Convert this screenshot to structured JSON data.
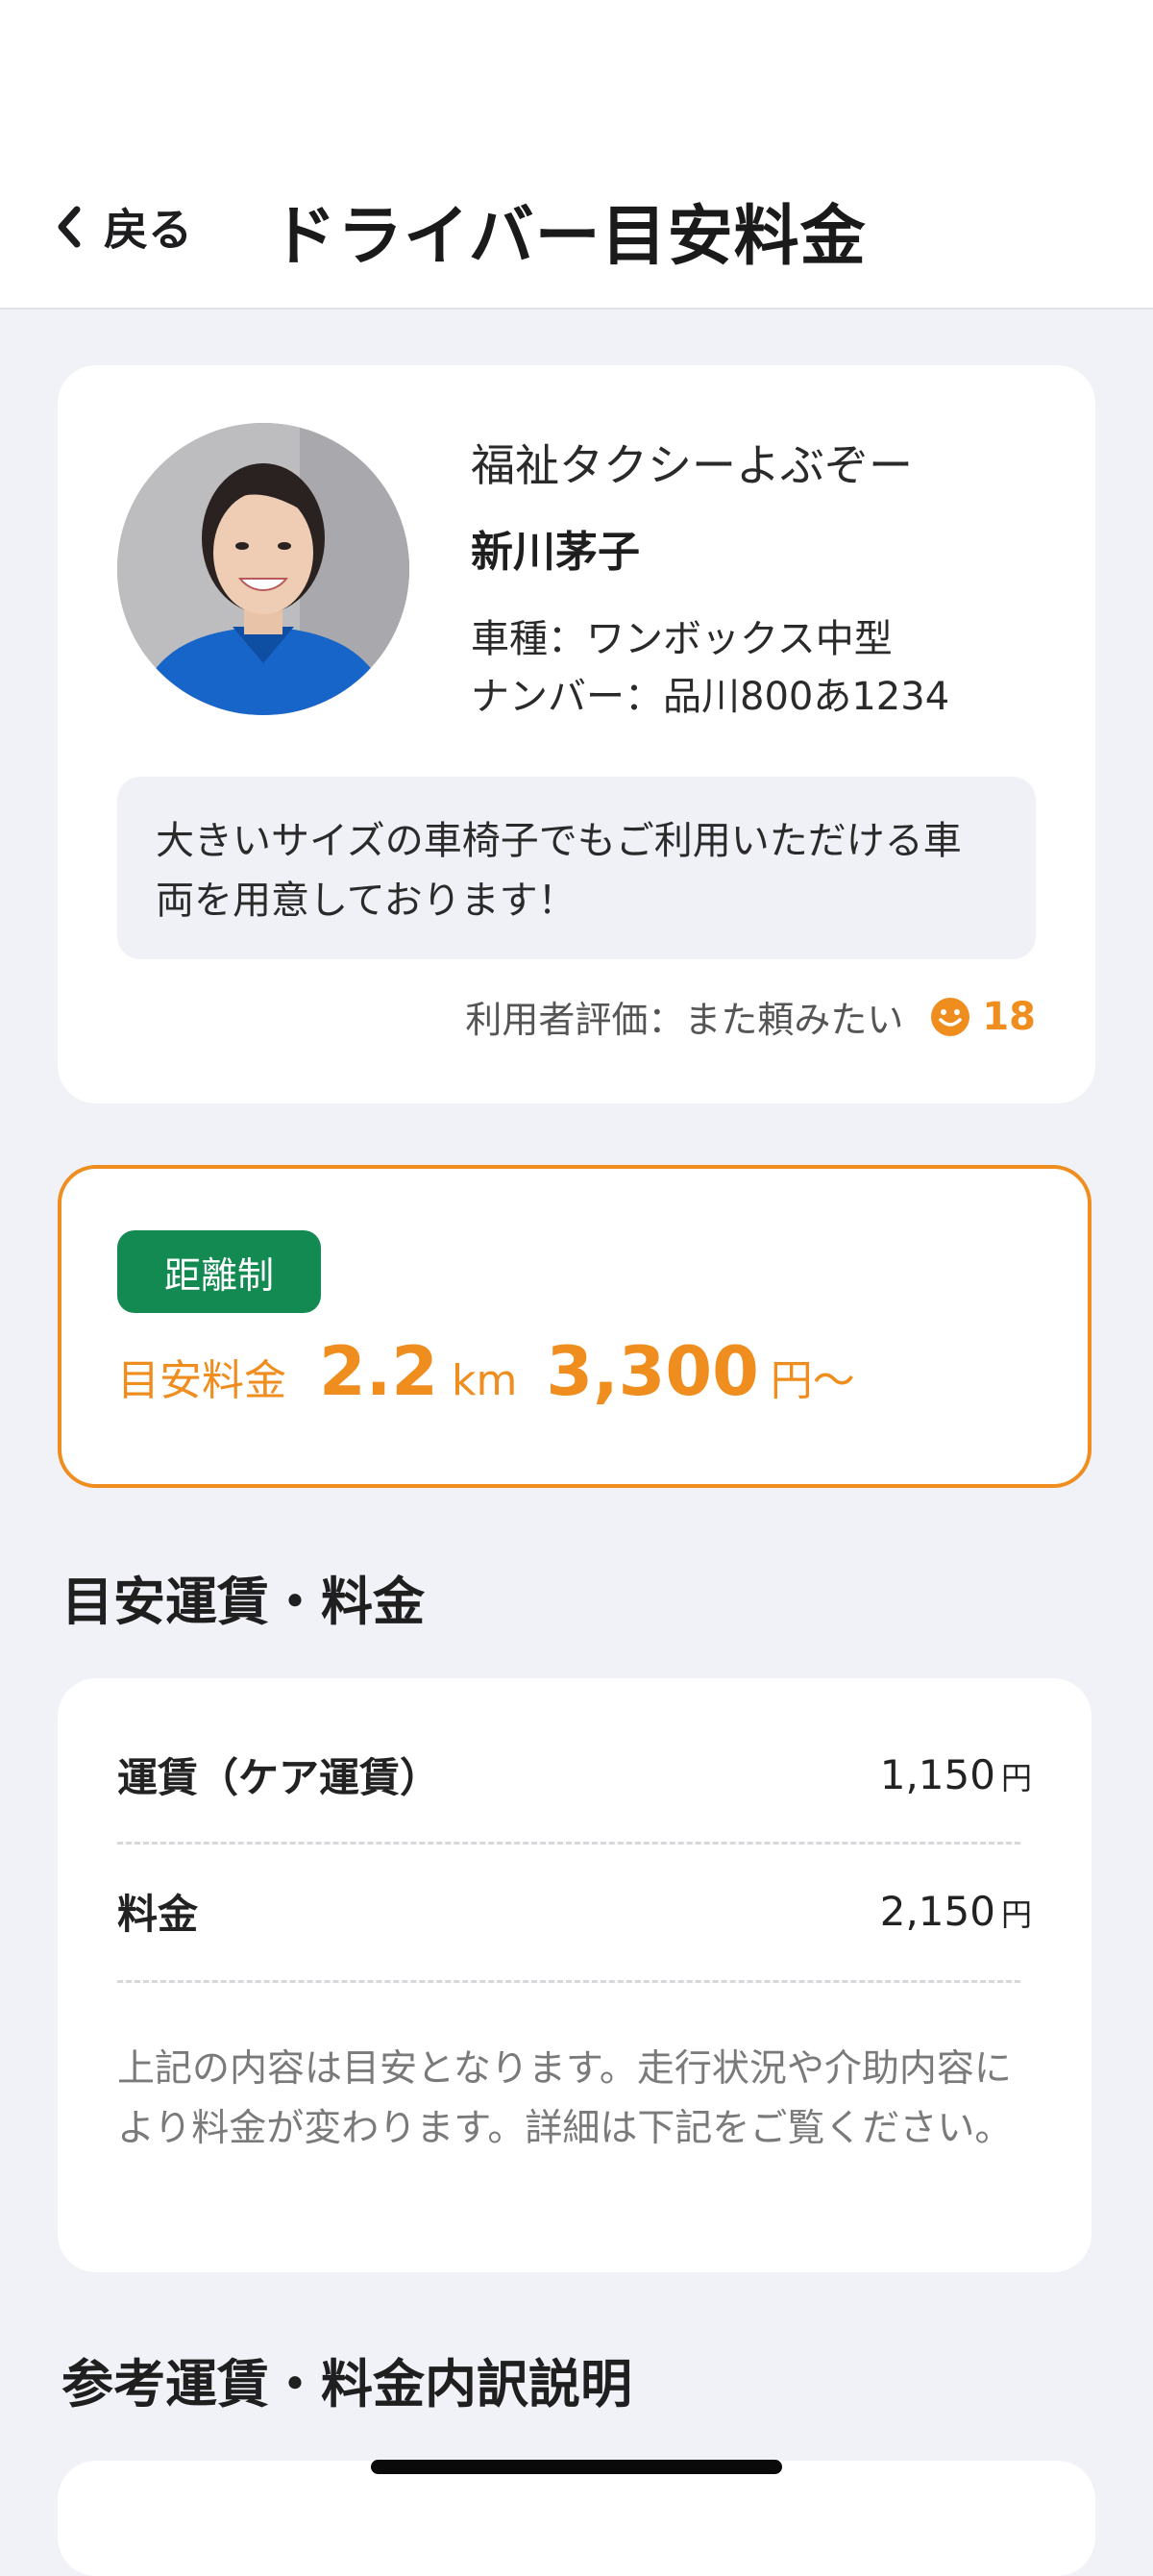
{
  "header": {
    "back_label": "戻る",
    "title": "ドライバー目安料金"
  },
  "driver": {
    "company": "福祉タクシーよぶぞー",
    "name": "新川茅子",
    "vehicle_type": "車種：ワンボックス中型",
    "plate": "ナンバー：品川800あ1234",
    "message": "大きいサイズの車椅子でもご利用いただける車両を用意しております！",
    "rating_label": "利用者評価：また頼みたい",
    "rating_count": "18"
  },
  "fare": {
    "system_badge": "距離制",
    "estimate_label": "目安料金",
    "distance": "2.2",
    "distance_unit": "km",
    "price": "3,300",
    "price_suffix": "円～"
  },
  "breakdown": {
    "section_title": "目安運賃・料金",
    "rows": [
      {
        "label": "運賃（ケア運賃）",
        "value": "1,150",
        "unit": "円"
      },
      {
        "label": "料金",
        "value": "2,150",
        "unit": "円"
      }
    ],
    "note": "上記の内容は目安となります。走行状況や介助内容により料金が変わります。詳細は下記をご覧ください。"
  },
  "reference": {
    "section_title": "参考運賃・料金内訳説明"
  },
  "colors": {
    "accent_orange": "#ef8d1e",
    "badge_green": "#138a52",
    "background": "#f1f2f8"
  },
  "icons": {
    "back": "chevron-left-icon",
    "rating": "smile-icon"
  }
}
